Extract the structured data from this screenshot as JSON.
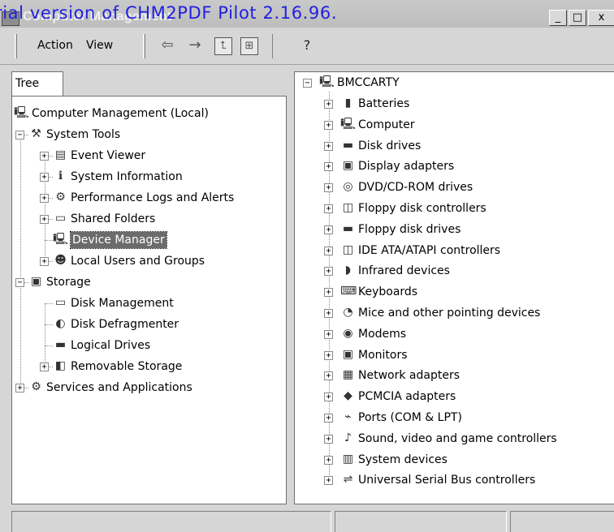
{
  "watermark": "rial version of CHM2PDF Pilot 2.16.96.",
  "window": {
    "title": "Computer Management",
    "buttons": {
      "minimize": "_",
      "maximize": "□",
      "close": "x"
    }
  },
  "menu": {
    "action": "Action",
    "view": "View"
  },
  "toolbar": {
    "back": "⇦",
    "forward": "→",
    "up_one_level": "⮤",
    "show_hide_tree": "⊞",
    "help": "?"
  },
  "tree_tab": "Tree",
  "tree": [
    {
      "label": "Computer Management (Local)",
      "icon": "computer-icon",
      "level": 0,
      "expander": ""
    },
    {
      "label": "System Tools",
      "icon": "tools-icon",
      "level": 1,
      "expander": "−"
    },
    {
      "label": "Event Viewer",
      "icon": "event-viewer-icon",
      "level": 2,
      "expander": "+"
    },
    {
      "label": "System Information",
      "icon": "system-info-icon",
      "level": 2,
      "expander": "+"
    },
    {
      "label": "Performance Logs and Alerts",
      "icon": "performance-icon",
      "level": 2,
      "expander": "+"
    },
    {
      "label": "Shared Folders",
      "icon": "shared-folder-icon",
      "level": 2,
      "expander": "+"
    },
    {
      "label": "Device Manager",
      "icon": "device-manager-icon",
      "level": 2,
      "expander": "",
      "selected": true
    },
    {
      "label": "Local Users and Groups",
      "icon": "users-icon",
      "level": 2,
      "expander": "+"
    },
    {
      "label": "Storage",
      "icon": "storage-icon",
      "level": 1,
      "expander": "−"
    },
    {
      "label": "Disk Management",
      "icon": "disk-management-icon",
      "level": 2,
      "expander": ""
    },
    {
      "label": "Disk Defragmenter",
      "icon": "defrag-icon",
      "level": 2,
      "expander": ""
    },
    {
      "label": "Logical Drives",
      "icon": "logical-drive-icon",
      "level": 2,
      "expander": ""
    },
    {
      "label": "Removable Storage",
      "icon": "removable-storage-icon",
      "level": 2,
      "expander": "+"
    },
    {
      "label": "Services and Applications",
      "icon": "services-icon",
      "level": 1,
      "expander": "+"
    }
  ],
  "device_root": {
    "label": "BMCCARTY",
    "icon": "computer-icon",
    "expander": "−"
  },
  "devices": [
    {
      "label": "Batteries",
      "icon": "battery-icon"
    },
    {
      "label": "Computer",
      "icon": "computer-icon"
    },
    {
      "label": "Disk drives",
      "icon": "disk-drive-icon"
    },
    {
      "label": "Display adapters",
      "icon": "monitor-icon"
    },
    {
      "label": "DVD/CD-ROM drives",
      "icon": "cdrom-icon"
    },
    {
      "label": "Floppy disk controllers",
      "icon": "floppy-controller-icon"
    },
    {
      "label": "Floppy disk drives",
      "icon": "floppy-drive-icon"
    },
    {
      "label": "IDE ATA/ATAPI controllers",
      "icon": "ide-controller-icon"
    },
    {
      "label": "Infrared devices",
      "icon": "infrared-icon"
    },
    {
      "label": "Keyboards",
      "icon": "keyboard-icon"
    },
    {
      "label": "Mice and other pointing devices",
      "icon": "mouse-icon"
    },
    {
      "label": "Modems",
      "icon": "modem-icon"
    },
    {
      "label": "Monitors",
      "icon": "monitor-icon"
    },
    {
      "label": "Network adapters",
      "icon": "network-adapter-icon"
    },
    {
      "label": "PCMCIA adapters",
      "icon": "pcmcia-icon"
    },
    {
      "label": "Ports (COM & LPT)",
      "icon": "port-icon"
    },
    {
      "label": "Sound, video and game controllers",
      "icon": "sound-icon"
    },
    {
      "label": "System devices",
      "icon": "system-devices-icon"
    },
    {
      "label": "Universal Serial Bus controllers",
      "icon": "usb-icon"
    }
  ],
  "device_expander": "+",
  "colors": {
    "watermark": "#2020e0",
    "selection": "#6b6b6b",
    "chrome": "#d6d6d6"
  }
}
